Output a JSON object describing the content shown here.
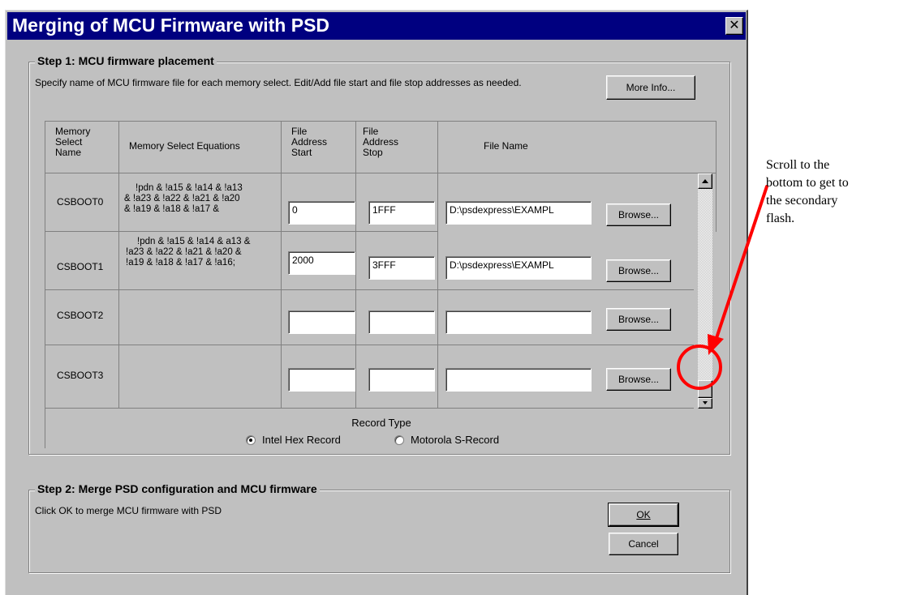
{
  "window": {
    "title": "Merging of MCU Firmware with PSD",
    "close_glyph": "✕"
  },
  "step1": {
    "title": "Step 1: MCU firmware placement",
    "instructions": "Specify name of MCU firmware file for each memory select.  Edit/Add file start and file stop addresses as needed.",
    "more_info_label": "More Info...",
    "headers": {
      "name": "Memory Select Name",
      "equations": "Memory Select Equations",
      "start": "File Address Start",
      "stop": "File Address Stop",
      "file": "File Name"
    },
    "rows": [
      {
        "name": "CSBOOT0",
        "eq1": "!pdn & !a15 & !a14 & !a13",
        "eq2": "& !a23 & !a22 & !a21 & !a20",
        "eq3": "& !a19 & !a18 & !a17 &",
        "start": "0",
        "stop": "1FFF",
        "file": "D:\\psdexpress\\EXAMPL",
        "browse": "Browse..."
      },
      {
        "name": "CSBOOT1",
        "eq1": "!pdn & !a15 & !a14 & a13 &",
        "eq2": "!a23 & !a22 & !a21 & !a20 &",
        "eq3": "!a19 & !a18 & !a17 & !a16;",
        "start": "2000",
        "stop": "3FFF",
        "file": "D:\\psdexpress\\EXAMPL",
        "browse": "Browse..."
      },
      {
        "name": "CSBOOT2",
        "eq1": "",
        "eq2": "",
        "eq3": "",
        "start": "",
        "stop": "",
        "file": "",
        "browse": "Browse..."
      },
      {
        "name": "CSBOOT3",
        "eq1": "",
        "eq2": "",
        "eq3": "",
        "start": "",
        "stop": "",
        "file": "",
        "browse": "Browse..."
      }
    ],
    "record_type": {
      "label": "Record Type",
      "options": [
        "Intel Hex Record",
        "Motorola S-Record"
      ],
      "selected": "Intel Hex Record"
    }
  },
  "step2": {
    "title": "Step 2: Merge PSD configuration and MCU firmware",
    "instructions": "Click OK to merge MCU firmware with PSD",
    "ok_label": "OK",
    "cancel_label": "Cancel"
  },
  "annotation": {
    "text": "Scroll to the\nbottom to get to\nthe secondary\nflash.",
    "color": "#ff0000"
  }
}
